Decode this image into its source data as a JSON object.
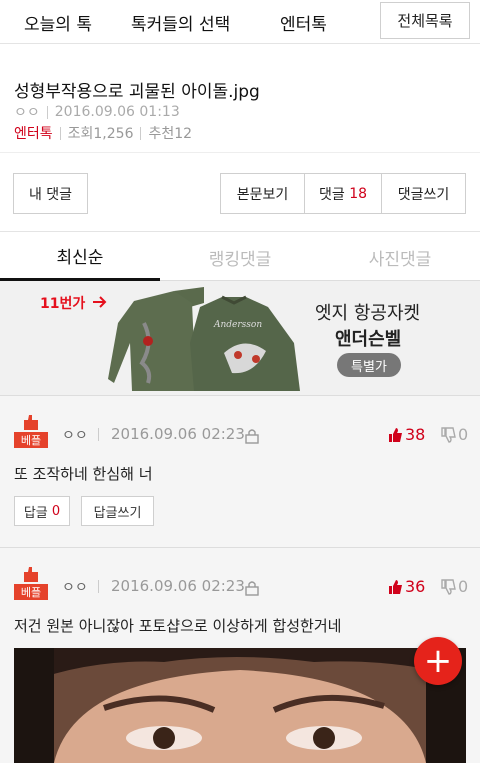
{
  "nav": {
    "items": [
      "오늘의 톡",
      "톡커들의 선택",
      "엔터톡"
    ],
    "all_button": "전체목록"
  },
  "article": {
    "title": "성형부작용으로 괴물된 아이돌.jpg",
    "author": "ㅇㅇ",
    "date": "2016.09.06 01:13",
    "category": "엔터톡",
    "views": "조회1,256",
    "recommend": "추천12"
  },
  "buttons": {
    "my_comments": "내 댓글",
    "view_post": "본문보기",
    "comments_label": "댓글",
    "comments_count": "18",
    "write_comment": "댓글쓰기"
  },
  "tabs": [
    "최신순",
    "랭킹댓글",
    "사진댓글"
  ],
  "ad": {
    "brand": "11번가",
    "line1": "엣지 항공자켓",
    "line2": "앤더슨벨",
    "badge": "특별가"
  },
  "comments": [
    {
      "badge": "베플",
      "user": "ㅇㅇ",
      "date": "2016.09.06 02:23",
      "likes": "38",
      "dislikes": "0",
      "text": "또 조작하네 한심해 너",
      "reply_label": "답글",
      "reply_count": "0",
      "write_reply": "답글쓰기"
    },
    {
      "badge": "베플",
      "user": "ㅇㅇ",
      "date": "2016.09.06 02:23",
      "likes": "36",
      "dislikes": "0",
      "text": "저건 원본 아니잖아 포토샵으로 이상하게 합성한거네"
    }
  ],
  "fab_symbol": "+",
  "colors": {
    "accent": "#d0021b",
    "best": "#e5422b",
    "fab": "#e5231b"
  }
}
